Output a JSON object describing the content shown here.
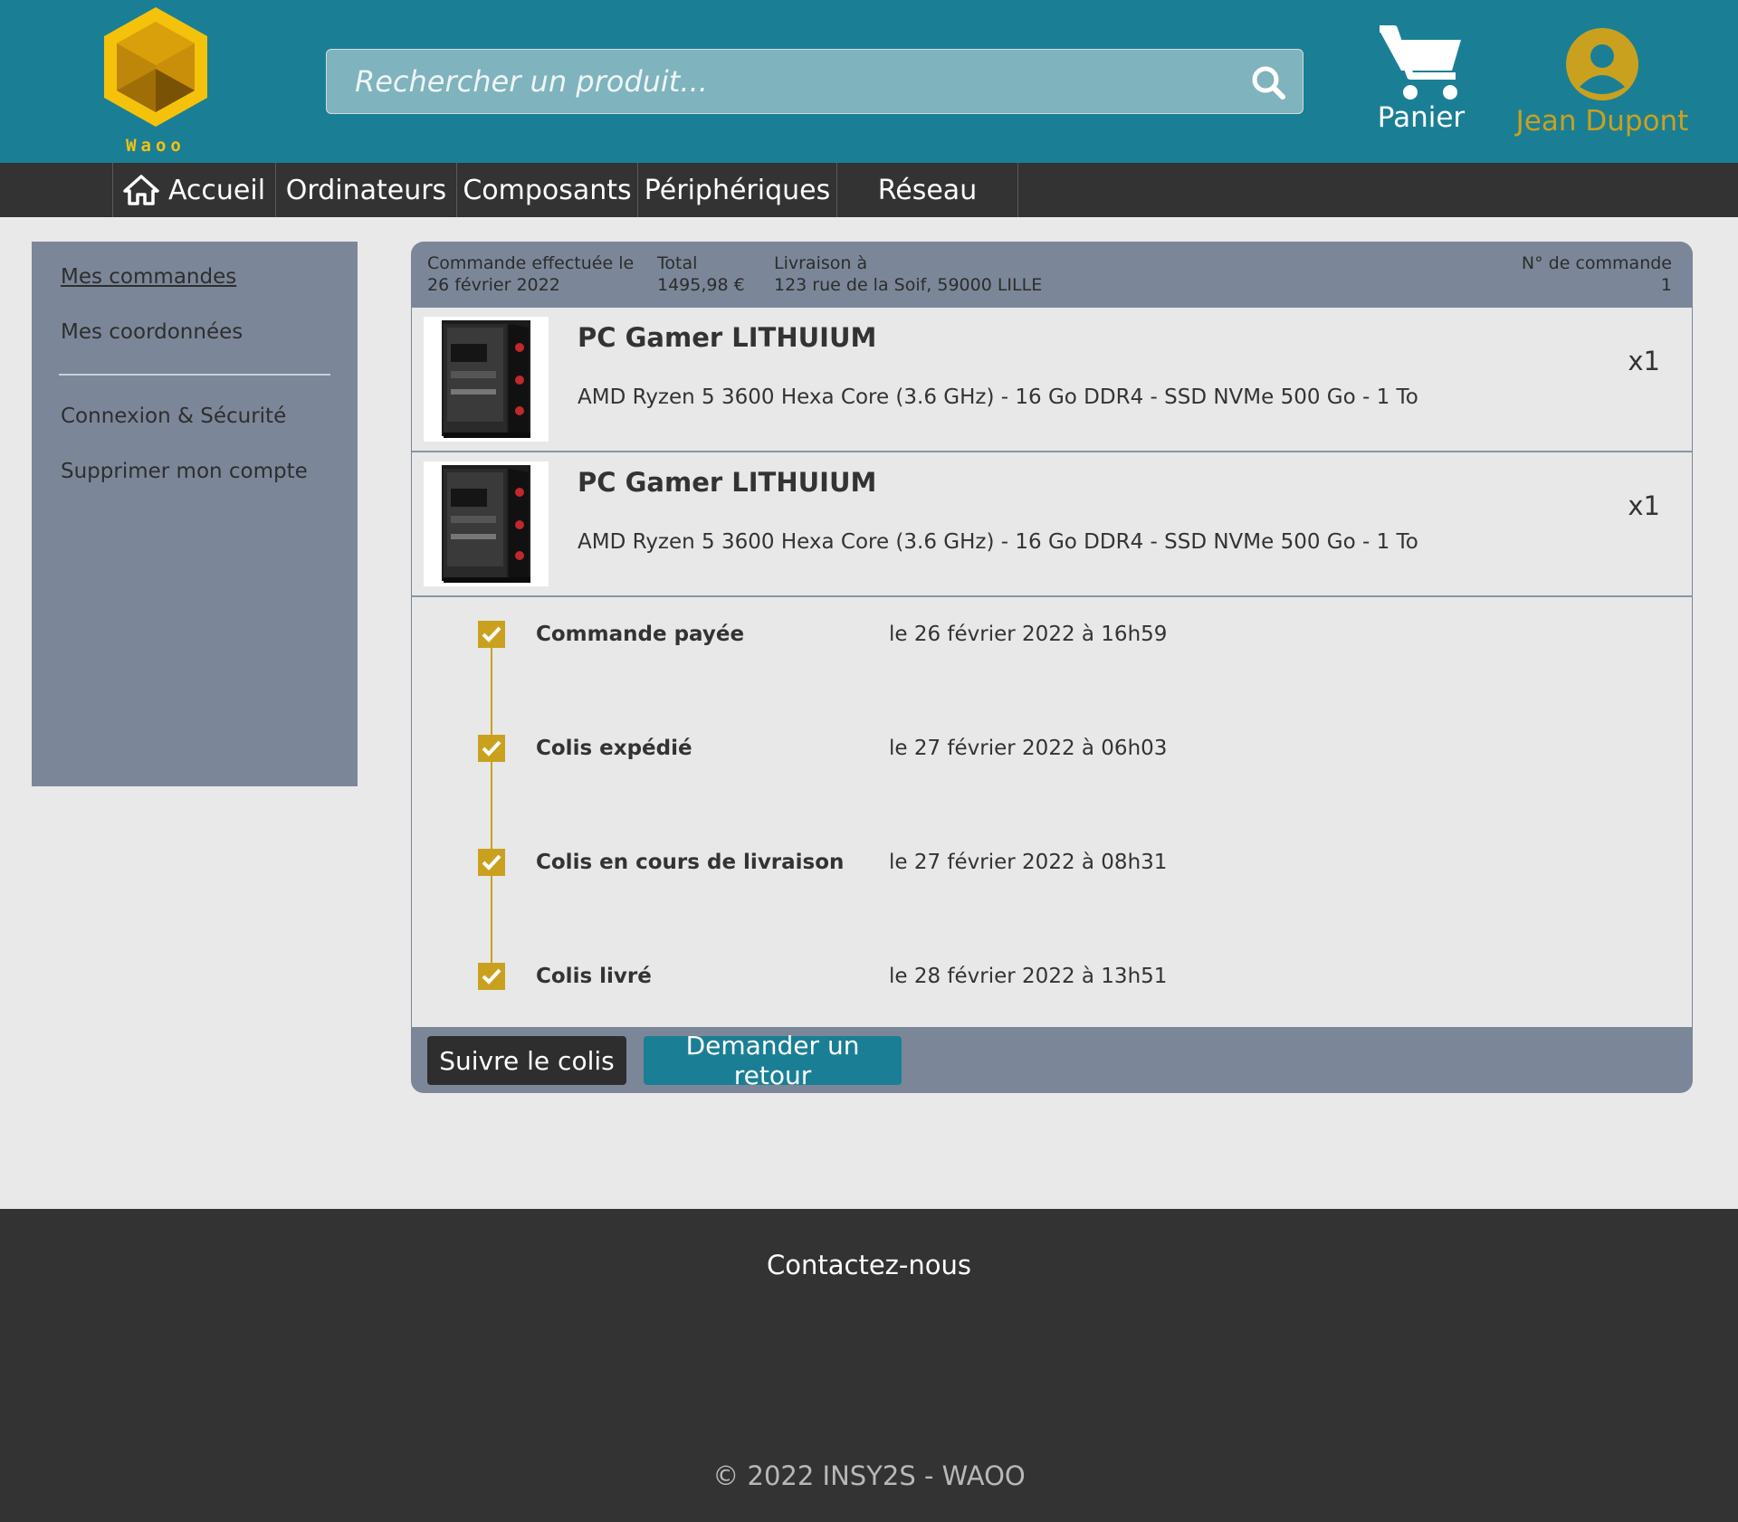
{
  "header": {
    "brand": "Waoo",
    "search_placeholder": "Rechercher un produit...",
    "cart_label": "Panier",
    "user_name": "Jean Dupont"
  },
  "nav": {
    "items": [
      {
        "label": "Accueil",
        "icon": "home-icon"
      },
      {
        "label": "Ordinateurs"
      },
      {
        "label": "Composants"
      },
      {
        "label": "Périphériques"
      },
      {
        "label": "Réseau"
      }
    ]
  },
  "sidebar": {
    "items": [
      {
        "label": "Mes commandes",
        "active": true
      },
      {
        "label": "Mes coordonnées"
      },
      {
        "label": "Connexion & Sécurité"
      },
      {
        "label": "Supprimer mon compte"
      }
    ]
  },
  "order": {
    "date_label": "Commande effectuée le",
    "date_value": "26 février 2022",
    "total_label": "Total",
    "total_value": "1495,98 €",
    "delivery_label": "Livraison à",
    "delivery_value": "123 rue de la Soif, 59000 LILLE",
    "number_label": "N° de commande",
    "number_value": "1",
    "items": [
      {
        "name": "PC Gamer LITHUIUM",
        "desc": "AMD Ryzen 5 3600 Hexa Core (3.6 GHz) - 16 Go DDR4 - SSD NVMe 500 Go - 1 To",
        "qty": "x1"
      },
      {
        "name": "PC Gamer LITHUIUM",
        "desc": "AMD Ryzen 5 3600 Hexa Core (3.6 GHz) - 16 Go DDR4 - SSD NVMe 500 Go - 1 To",
        "qty": "x1"
      }
    ],
    "steps": [
      {
        "title": "Commande payée",
        "date": "le 26 février 2022 à 16h59"
      },
      {
        "title": "Colis expédié",
        "date": "le 27 février 2022 à 06h03"
      },
      {
        "title": "Colis en cours de livraison",
        "date": "le 27 février 2022 à 08h31"
      },
      {
        "title": "Colis livré",
        "date": "le 28 février 2022 à 13h51"
      }
    ],
    "track_button": "Suivre le colis",
    "return_button": "Demander un retour"
  },
  "footer": {
    "contact": "Contactez-nous",
    "copyright": "© 2022 INSY2S - WAOO"
  },
  "colors": {
    "header_bg": "#1a7f95",
    "accent_gold": "#c9a11f",
    "logo_yellow": "#f5c20b",
    "nav_bg": "#333333",
    "panel_bg": "#7b8799"
  }
}
